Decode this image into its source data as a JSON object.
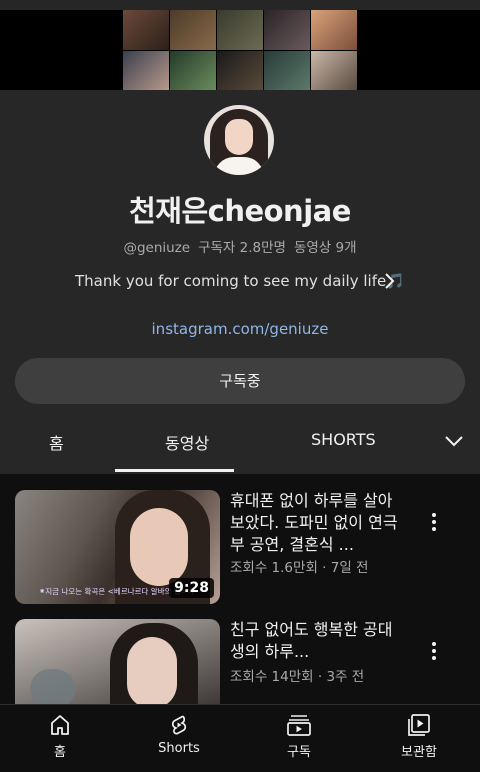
{
  "channel": {
    "name": "천재은cheonjae",
    "handle": "@geniuze",
    "subscribers": "구독자 2.8만명",
    "video_count": "동영상 9개",
    "description": "Thank you for coming to see my daily life🎵",
    "link": "instagram.com/geniuze",
    "subscribe_label": "구독중"
  },
  "tabs": [
    {
      "label": "홈",
      "active": false
    },
    {
      "label": "동영상",
      "active": true
    },
    {
      "label": "SHORTS",
      "active": false
    }
  ],
  "videos": [
    {
      "title": "휴대폰 없이 하루를 살아보았다. 도파민 없이 연극부 공연, 결혼식 ...",
      "stats": "조회수 1.6만회 · 7일 전",
      "duration": "9:28",
      "thumb_caption": "⁕지금 나오는 확곡은 <베르나르다 알바의 집>이"
    },
    {
      "title": "친구 없어도 행복한 공대생의 하루...",
      "stats": "조회수 14만회 · 3주 전"
    }
  ],
  "bottom_nav": [
    {
      "label": "홈",
      "icon": "home-icon"
    },
    {
      "label": "Shorts",
      "icon": "shorts-icon"
    },
    {
      "label": "구독",
      "icon": "subscriptions-icon"
    },
    {
      "label": "보관함",
      "icon": "library-icon"
    }
  ],
  "colors": {
    "background": "#0f0f0f",
    "header_panel": "#272727",
    "link": "#8fb7e8",
    "subscribe_button": "#3f3f3f"
  }
}
